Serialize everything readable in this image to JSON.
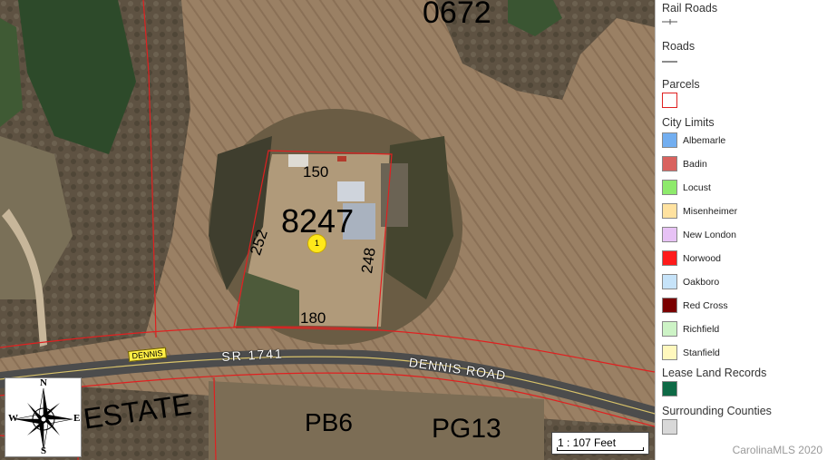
{
  "map": {
    "parcel_number_top": "0672",
    "parcel_number": "8247",
    "dimensions": {
      "top": "150",
      "bottom": "180",
      "left": "252",
      "right": "248"
    },
    "road_name": "DENNIS ROAD",
    "route_label": "SR  1741",
    "road_badge": "DENNIS",
    "subdivision_label": "ESTATE",
    "plat_book": "PB6",
    "plat_page": "PG13",
    "marker_number": "1",
    "scale_text": "1 : 107 Feet",
    "compass": {
      "north": "N",
      "south": "S",
      "east": "E",
      "west": "W"
    }
  },
  "legend": {
    "sections": [
      {
        "title": "Rail Roads",
        "symbol": "rail-line"
      },
      {
        "title": "Roads",
        "symbol": "road-line"
      },
      {
        "title": "Parcels",
        "symbol": "parcel-outline"
      },
      {
        "title": "City Limits"
      }
    ],
    "city_limits": [
      {
        "label": "Albemarle",
        "color": "#72aef0"
      },
      {
        "label": "Badin",
        "color": "#d9625e"
      },
      {
        "label": "Locust",
        "color": "#8eea6c"
      },
      {
        "label": "Misenheimer",
        "color": "#ffe2a0"
      },
      {
        "label": "New London",
        "color": "#e7c2f5"
      },
      {
        "label": "Norwood",
        "color": "#ff1b1b"
      },
      {
        "label": "Oakboro",
        "color": "#c6e3f9"
      },
      {
        "label": "Red Cross",
        "color": "#7a0000"
      },
      {
        "label": "Richfield",
        "color": "#cdf3c6"
      },
      {
        "label": "Stanfield",
        "color": "#fff8bd"
      }
    ],
    "lease_land": {
      "title": "Lease Land Records",
      "color": "#0e6a46"
    },
    "counties": {
      "title": "Surrounding Counties",
      "color": "#d8d8d8"
    },
    "parcel_color": "#e02020"
  },
  "copyright": "CarolinaMLS 2020"
}
